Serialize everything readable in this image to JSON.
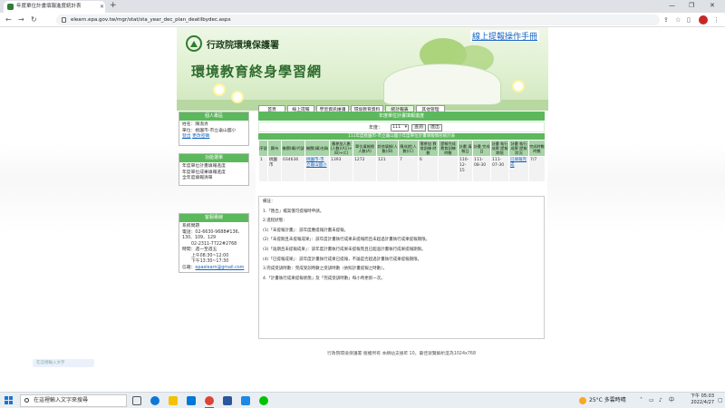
{
  "browser": {
    "tab_title": "年度單位計畫填報進度統計表",
    "url": "elearn.epa.gov.tw/mgr/stat/sta_year_dec_plan_deatilbydec.aspx"
  },
  "header": {
    "agency_name": "行政院環境保護署",
    "site_title": "環境教育終身學習網",
    "manual_link": "線上提報操作手冊"
  },
  "menu": [
    "首頁",
    "線上提報",
    "學習資訊維護",
    "環境教育資料",
    "統計報表",
    "其他管理"
  ],
  "member": {
    "title": "個人專區",
    "name_line": "姓名：陳淑貞",
    "unit_line": "單位：桃園市-市立龜山國小",
    "logout": "登出",
    "change_pw": "更改密碼"
  },
  "functions": {
    "title": "功能選單",
    "items": [
      "年度單位計畫填報進度",
      "年度單位成果填報進度",
      "全年度填報清單"
    ]
  },
  "contact": {
    "title": "客服專線",
    "lines": [
      "系統問題",
      "電話：02-6630-9688#136、130、109、129",
      "02-2311-7722#2768",
      "時間：週一至週五",
      "上午08:30~12:00",
      "下午13:30~17:30"
    ],
    "email_label": "信箱：",
    "email": "epaelearn@gmail.com"
  },
  "report": {
    "title": "年度單位計畫填報進度",
    "filter_label": "年度：",
    "year_value": "111",
    "query_button": "查詢",
    "export_button": "匯出",
    "table_title": "111年度桃園市-市立龜山國小年度單位計畫填報情形統計表",
    "columns": [
      "序號",
      "縣市",
      "機關(構)代號",
      "機關(構)名稱",
      "應參加人數(人數)(A1)+(B)+(C)",
      "單位填報總人數(A)",
      "其他填報(人數)(B)",
      "應成就(人數)(C)",
      "需參加 教育訓練 時數",
      "提報完成 教育訓練 時數",
      "計畫 填報日",
      "計畫 完成日",
      "計畫 執行成果 提報期限",
      "計畫 執行成果 提報狀況",
      "完成時數 時數"
    ],
    "row": {
      "seq": "1",
      "county": "桃園市",
      "code": "034636",
      "unit_name": "桃園市-市立龜山國小",
      "required": "1393",
      "unit_total": "1272",
      "other": "121",
      "achieve": "7",
      "train_hours": "6",
      "done_hours": "",
      "fill_date": "110-12-15",
      "complete_date": "111-08-30",
      "deadline": "111-07-30",
      "status": "已填報完成",
      "hours_done": "7/7"
    }
  },
  "notes": [
    "備註：",
    "1.「匯出」檔案僅可提報時申請。",
    "2.進程狀態：",
    "(1)「未提報計畫」：該年度應提報計畫未提報。",
    "(2)「未提期且未提報成果」：該年度計畫執行成果未提報而且未超過計畫執行成果提報期限。",
    "(3)「逾期且未提報成果」：該年度計畫執行成果未提報而且已超過計畫執行成果提報期限。",
    "(4)「已提報成果」：該年度計畫執行成果已提報，不論是否超過計畫執行成果提報期限。",
    "3.完成受訓時數：完成受訓時數之受訓時數（依照計畫提報之時數）。",
    "4.「計畫執行成果提報狀態」及「完成受訓時數」每小時更新一次。"
  ],
  "footer": "行政院環境保護署 版權所有 本網站支援IE 10，最佳瀏覽解析度為1024x768",
  "ghost_tab": "在這裡輸入文字",
  "taskbar": {
    "search_placeholder": "在這裡輸入文字來搜尋",
    "weather": "25°C 多雲時晴",
    "time": "下午 05:03",
    "date": "2022/4/27"
  },
  "colors": {
    "accent_green": "#5cb85c",
    "header_green": "#a6d4a6",
    "link_blue": "#1565c0"
  }
}
